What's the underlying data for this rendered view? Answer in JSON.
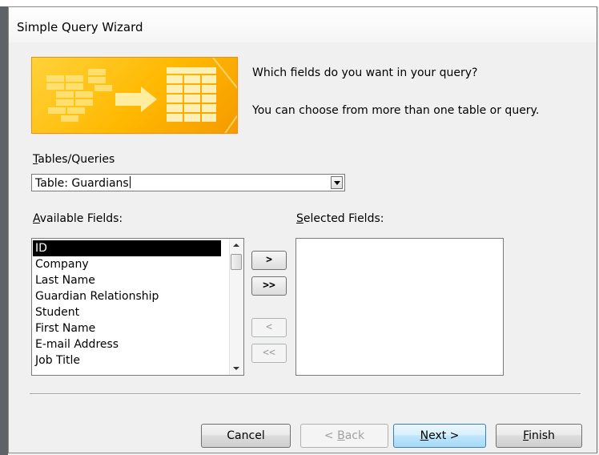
{
  "window": {
    "title": "Simple Query Wizard"
  },
  "intro": {
    "question": "Which fields do you want in your query?",
    "hint": "You can choose from more than one table or query."
  },
  "tables_queries": {
    "label": "Tables/Queries",
    "accel": "T",
    "label_rest": "ables/Queries",
    "selected": "Table: Guardians"
  },
  "available_fields": {
    "accel": "A",
    "label_rest": "vailable Fields:",
    "items": [
      "ID",
      "Company",
      "Last Name",
      "Guardian Relationship",
      "Student",
      "First Name",
      "E-mail Address",
      "Job Title"
    ],
    "selected_index": 0
  },
  "selected_fields": {
    "accel": "S",
    "label_rest": "elected Fields:",
    "items": []
  },
  "move_buttons": {
    "add_one": ">",
    "add_all": ">>",
    "remove_one": "<",
    "remove_all": "<<"
  },
  "buttons": {
    "cancel": "Cancel",
    "back_prefix": "< ",
    "back_accel": "B",
    "back_rest": "ack",
    "next_accel": "N",
    "next_rest": "ext >",
    "finish_accel": "F",
    "finish_rest": "inish"
  },
  "colors": {
    "banner": "#ffb800",
    "selection": "#000000",
    "default_button": "#bee6fd"
  }
}
